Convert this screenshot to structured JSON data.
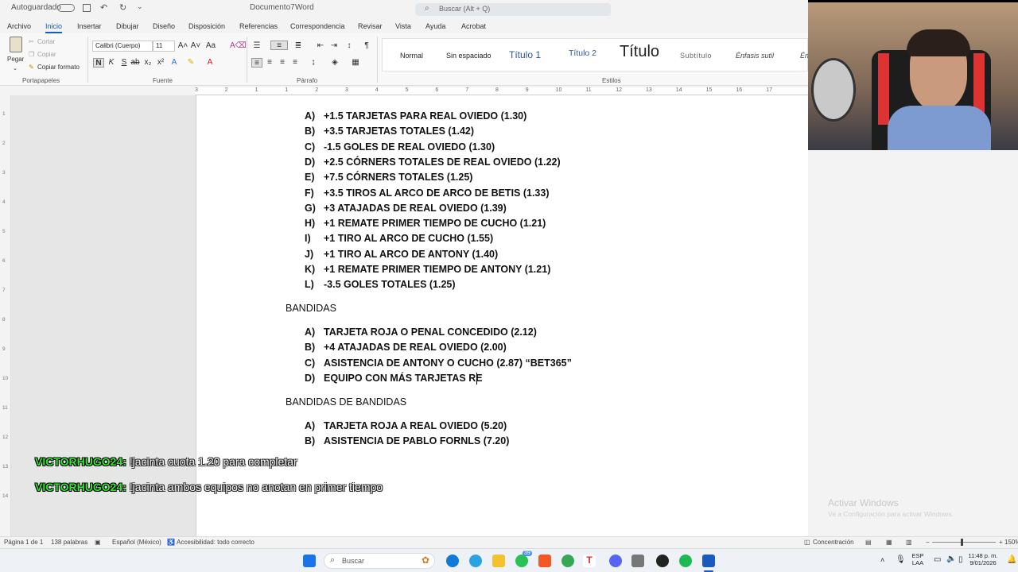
{
  "titlebar": {
    "autosave_label": "Autoguardado",
    "document_title": "Documento7",
    "app_name": "Word",
    "search_placeholder": "Buscar (Alt + Q)"
  },
  "menu": {
    "items": [
      "Archivo",
      "Inicio",
      "Insertar",
      "Dibujar",
      "Diseño",
      "Disposición",
      "Referencias",
      "Correspondencia",
      "Revisar",
      "Vista",
      "Ayuda",
      "Acrobat"
    ],
    "active": "Inicio"
  },
  "ribbon": {
    "clipboard": {
      "paste": "Pegar",
      "cut": "Cortar",
      "copy": "Copiar",
      "format_painter": "Copiar formato",
      "group_label": "Portapapeles"
    },
    "font": {
      "family": "Calibri (Cuerpo)",
      "size": "11",
      "group_label": "Fuente"
    },
    "paragraph": {
      "group_label": "Párrafo"
    },
    "styles": {
      "items": [
        "Normal",
        "Sin espaciado",
        "Título 1",
        "Título 2",
        "Título",
        "Subtítulo",
        "Énfasis sutil",
        "Én"
      ],
      "group_label": "Estilos"
    }
  },
  "ruler_numbers": [
    "3",
    "2",
    "1",
    "1",
    "2",
    "3",
    "4",
    "5",
    "6",
    "7",
    "8",
    "9",
    "10",
    "11",
    "12",
    "13",
    "14",
    "15",
    "16",
    "17"
  ],
  "vruler_numbers": [
    "1",
    "2",
    "3",
    "4",
    "5",
    "6",
    "7",
    "8",
    "9",
    "10",
    "11",
    "12",
    "13",
    "14"
  ],
  "document": {
    "list1": [
      {
        "letter": "A)",
        "text": "+1.5 TARJETAS PARA REAL OVIEDO (1.30)"
      },
      {
        "letter": "B)",
        "text": "+3.5 TARJETAS TOTALES (1.42)"
      },
      {
        "letter": "C)",
        "text": "-1.5 GOLES DE REAL OVIEDO (1.30)"
      },
      {
        "letter": "D)",
        "text": "+2.5 CÓRNERS TOTALES DE REAL OVIEDO (1.22)"
      },
      {
        "letter": "E)",
        "text": "+7.5 CÓRNERS TOTALES (1.25)"
      },
      {
        "letter": "F)",
        "text": "+3.5 TIROS AL ARCO DE ARCO DE BETIS (1.33)"
      },
      {
        "letter": "G)",
        "text": "+3 ATAJADAS DE REAL OVIEDO (1.39)"
      },
      {
        "letter": "H)",
        "text": "+1 REMATE PRIMER TIEMPO DE CUCHO (1.21)"
      },
      {
        "letter": "I)",
        "text": "+1 TIRO AL ARCO DE CUCHO (1.55)"
      },
      {
        "letter": "J)",
        "text": "+1 TIRO AL ARCO DE ANTONY (1.40)"
      },
      {
        "letter": "K)",
        "text": "+1 REMATE PRIMER TIEMPO DE ANTONY (1.21)"
      },
      {
        "letter": "L)",
        "text": "-3.5 GOLES TOTALES (1.25)"
      }
    ],
    "heading2": "BANDIDAS",
    "list2": [
      {
        "letter": "A)",
        "text": "TARJETA ROJA O PENAL CONCEDIDO (2.12)"
      },
      {
        "letter": "B)",
        "text": "+4 ATAJADAS DE REAL OVIEDO (2.00)"
      },
      {
        "letter": "C)",
        "text": "ASISTENCIA DE ANTONY O CUCHO (2.87) “BET365”"
      },
      {
        "letter": "D)",
        "text": "EQUIPO CON MÁS TARJETAS RE"
      }
    ],
    "heading3": "BANDIDAS DE BANDIDAS",
    "list3": [
      {
        "letter": "A)",
        "text": "TARJETA ROJA A REAL OVIEDO (5.20)"
      },
      {
        "letter": "B)",
        "text": "ASISTENCIA DE PABLO FORNLS (7.20)"
      }
    ]
  },
  "chat": [
    {
      "user": "VICTORHUGO24:",
      "text": "!jacinta cuota 1.20 para completar"
    },
    {
      "user": "VICTORHUGO24:",
      "text": "!jacinta ambos equipos no anotan en primer tiempo"
    }
  ],
  "watermark": {
    "title": "Activar Windows",
    "subtitle": "Ve a Configuración para activar Windows."
  },
  "statusbar": {
    "page": "Página 1 de 1",
    "words": "138 palabras",
    "language": "Español (México)",
    "accessibility": "Accesibilidad: todo correcto",
    "focus": "Concentración",
    "zoom": "150%"
  },
  "taskbar": {
    "search_label": "Buscar",
    "badge": "39",
    "lang1": "ESP",
    "lang2": "LAA",
    "time": "11:48 p. m.",
    "date": "9/01/2026"
  },
  "colors": {
    "accent": "#185abd",
    "chat_user": "#32e632"
  }
}
